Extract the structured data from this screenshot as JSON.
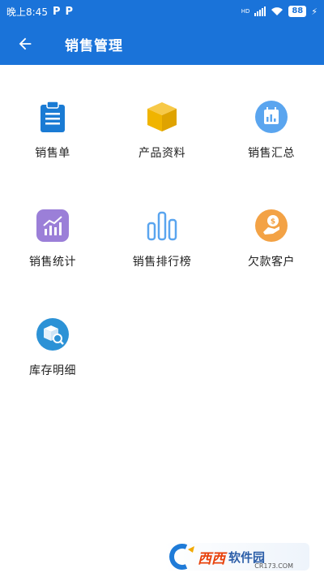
{
  "status_bar": {
    "time": "晚上8:45",
    "badge1": "P",
    "badge2": "P",
    "network": "HD",
    "battery": "88",
    "charging": "⚡"
  },
  "app_bar": {
    "title": "销售管理",
    "back_icon": "arrow-left-icon",
    "background": "#1a73d9"
  },
  "menu": {
    "items": [
      {
        "label": "销售单",
        "icon": "clipboard-icon",
        "color": "#1a7bd4"
      },
      {
        "label": "产品资料",
        "icon": "box-icon",
        "color": "#f0b400"
      },
      {
        "label": "销售汇总",
        "icon": "calendar-chart-icon",
        "color": "#5aa5ef"
      },
      {
        "label": "销售统计",
        "icon": "trend-chart-icon",
        "color": "#9b7fd8"
      },
      {
        "label": "销售排行榜",
        "icon": "bar-chart-icon",
        "color": "#5aa5ef"
      },
      {
        "label": "欠款客户",
        "icon": "money-hand-icon",
        "color": "#f3a245"
      },
      {
        "label": "库存明细",
        "icon": "package-search-icon",
        "color": "#2c92d6"
      }
    ]
  },
  "watermark": {
    "brand": "西西",
    "name": "软件园",
    "site": "CR173.COM"
  }
}
